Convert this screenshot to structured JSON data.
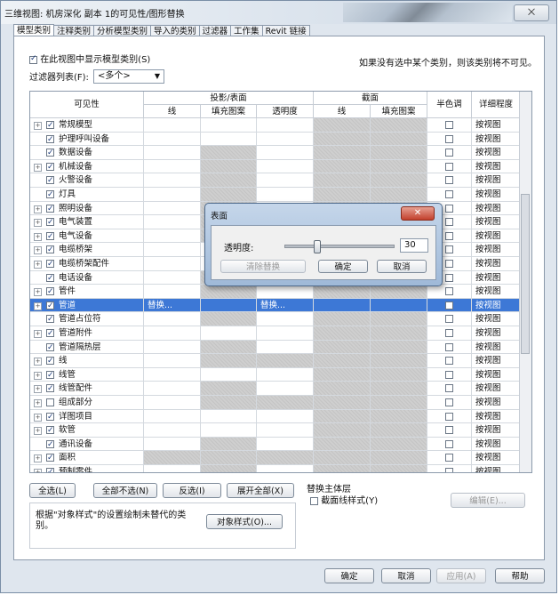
{
  "window": {
    "title": "三维视图: 机房深化 副本 1的可见性/图形替换",
    "close_label": "⨉"
  },
  "tabs": [
    "模型类别",
    "注释类别",
    "分析模型类别",
    "导入的类别",
    "过滤器",
    "工作集",
    "Revit 链接"
  ],
  "show_categories_label": "在此视图中显示模型类别(S)",
  "note": "如果没有选中某个类别，则该类别将不可见。",
  "filter": {
    "label": "过滤器列表(F):",
    "value": "<多个>"
  },
  "headers": {
    "visibility": "可见性",
    "projection": "投影/表面",
    "cut": "截面",
    "line": "线",
    "fill": "填充图案",
    "transparency": "透明度",
    "cut_line": "线",
    "cut_fill": "填充图案",
    "halftone": "半色调",
    "detail": "详细程度"
  },
  "rows": [
    {
      "name": "常规模型",
      "exp": true,
      "checked": true
    },
    {
      "name": "护理呼叫设备",
      "exp": false,
      "checked": true
    },
    {
      "name": "数据设备",
      "exp": false,
      "checked": true
    },
    {
      "name": "机械设备",
      "exp": true,
      "checked": true
    },
    {
      "name": "火警设备",
      "exp": false,
      "checked": true
    },
    {
      "name": "灯具",
      "exp": false,
      "checked": true
    },
    {
      "name": "照明设备",
      "exp": true,
      "checked": true
    },
    {
      "name": "电气装置",
      "exp": true,
      "checked": true
    },
    {
      "name": "电气设备",
      "exp": true,
      "checked": true
    },
    {
      "name": "电缆桥架",
      "exp": true,
      "checked": true
    },
    {
      "name": "电缆桥架配件",
      "exp": true,
      "checked": true
    },
    {
      "name": "电话设备",
      "exp": false,
      "checked": true
    },
    {
      "name": "管件",
      "exp": true,
      "checked": true
    },
    {
      "name": "管道",
      "exp": true,
      "checked": true,
      "selected": true,
      "line_btn": "替换...",
      "trans_btn": "替换..."
    },
    {
      "name": "管道占位符",
      "exp": false,
      "checked": true
    },
    {
      "name": "管道附件",
      "exp": true,
      "checked": true
    },
    {
      "name": "管道隔热层",
      "exp": false,
      "checked": true
    },
    {
      "name": "线",
      "exp": true,
      "checked": true
    },
    {
      "name": "线管",
      "exp": true,
      "checked": true
    },
    {
      "name": "线管配件",
      "exp": true,
      "checked": true
    },
    {
      "name": "组成部分",
      "exp": true,
      "checked": false
    },
    {
      "name": "详图项目",
      "exp": true,
      "checked": true
    },
    {
      "name": "软管",
      "exp": true,
      "checked": true
    },
    {
      "name": "通讯设备",
      "exp": false,
      "checked": true
    },
    {
      "name": "面积",
      "exp": true,
      "checked": true
    },
    {
      "name": "预制零件",
      "exp": true,
      "checked": true
    }
  ],
  "detail_value": "按视图",
  "buttons": {
    "select_all": "全选(L)",
    "select_none": "全部不选(N)",
    "invert": "反选(I)",
    "expand_all": "展开全部(X)",
    "object_styles": "对象样式(O)...",
    "edit": "编辑(E)...",
    "ok": "确定",
    "cancel": "取消",
    "apply": "应用(A)",
    "help": "帮助"
  },
  "host_layer": {
    "title": "替换主体层",
    "cut_line_styles": "截面线样式(Y)"
  },
  "info_text": "根据\"对象样式\"的设置绘制未替代的类别。",
  "dialog": {
    "title": "表面",
    "transparency_label": "透明度:",
    "transparency_value": "30",
    "transparency_level": 30,
    "clear_btn": "清除替换",
    "ok_btn": "确定",
    "cancel_btn": "取消"
  }
}
